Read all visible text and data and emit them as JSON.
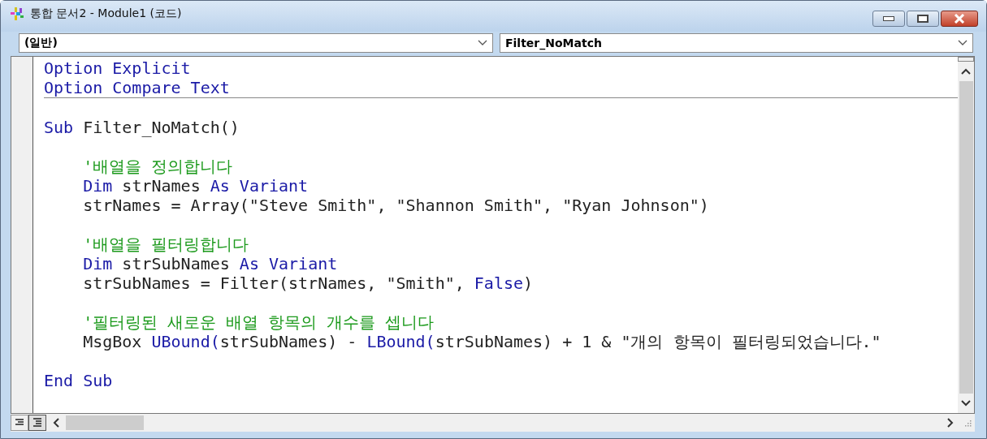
{
  "window": {
    "title": "통합 문서2 - Module1 (코드)"
  },
  "object_box": {
    "value": "(일반)"
  },
  "procedure_box": {
    "value": "Filter_NoMatch"
  },
  "code": {
    "sections": [
      {
        "lines": [
          {
            "segments": [
              {
                "kind": "keyword",
                "text": "Option Explicit"
              }
            ]
          },
          {
            "segments": [
              {
                "kind": "keyword",
                "text": "Option Compare Text"
              }
            ]
          }
        ]
      },
      {
        "lines": [
          {
            "blank_before": true,
            "segments": [
              {
                "kind": "keyword",
                "text": "Sub"
              },
              {
                "kind": "plain",
                "text": " Filter_NoMatch()"
              }
            ]
          },
          {
            "blank_before": true,
            "segments": [
              {
                "kind": "comment",
                "text": "    '배열을 정의합니다"
              }
            ]
          },
          {
            "segments": [
              {
                "kind": "keyword",
                "text": "    Dim"
              },
              {
                "kind": "plain",
                "text": " strNames "
              },
              {
                "kind": "keyword",
                "text": "As Variant"
              }
            ]
          },
          {
            "segments": [
              {
                "kind": "plain",
                "text": "    strNames = Array(\"Steve Smith\", \"Shannon Smith\", \"Ryan Johnson\")"
              }
            ]
          },
          {
            "blank_before": true,
            "segments": [
              {
                "kind": "comment",
                "text": "    '배열을 필터링합니다"
              }
            ]
          },
          {
            "segments": [
              {
                "kind": "keyword",
                "text": "    Dim"
              },
              {
                "kind": "plain",
                "text": " strSubNames "
              },
              {
                "kind": "keyword",
                "text": "As Variant"
              }
            ]
          },
          {
            "segments": [
              {
                "kind": "plain",
                "text": "    strSubNames = Filter(strNames, \"Smith\", "
              },
              {
                "kind": "keyword",
                "text": "False"
              },
              {
                "kind": "plain",
                "text": ")"
              }
            ]
          },
          {
            "blank_before": true,
            "segments": [
              {
                "kind": "comment",
                "text": "    '필터링된 새로운 배열 항목의 개수를 셉니다"
              }
            ]
          },
          {
            "segments": [
              {
                "kind": "plain",
                "text": "    MsgBox "
              },
              {
                "kind": "keyword",
                "text": "UBound("
              },
              {
                "kind": "plain",
                "text": "strSubNames) - "
              },
              {
                "kind": "keyword",
                "text": "LBound("
              },
              {
                "kind": "plain",
                "text": "strSubNames) + 1 & \"개의 항목이 필터링되었습니다.\""
              }
            ]
          },
          {
            "blank_before": true,
            "segments": [
              {
                "kind": "keyword",
                "text": "End Sub"
              }
            ]
          }
        ]
      }
    ]
  }
}
